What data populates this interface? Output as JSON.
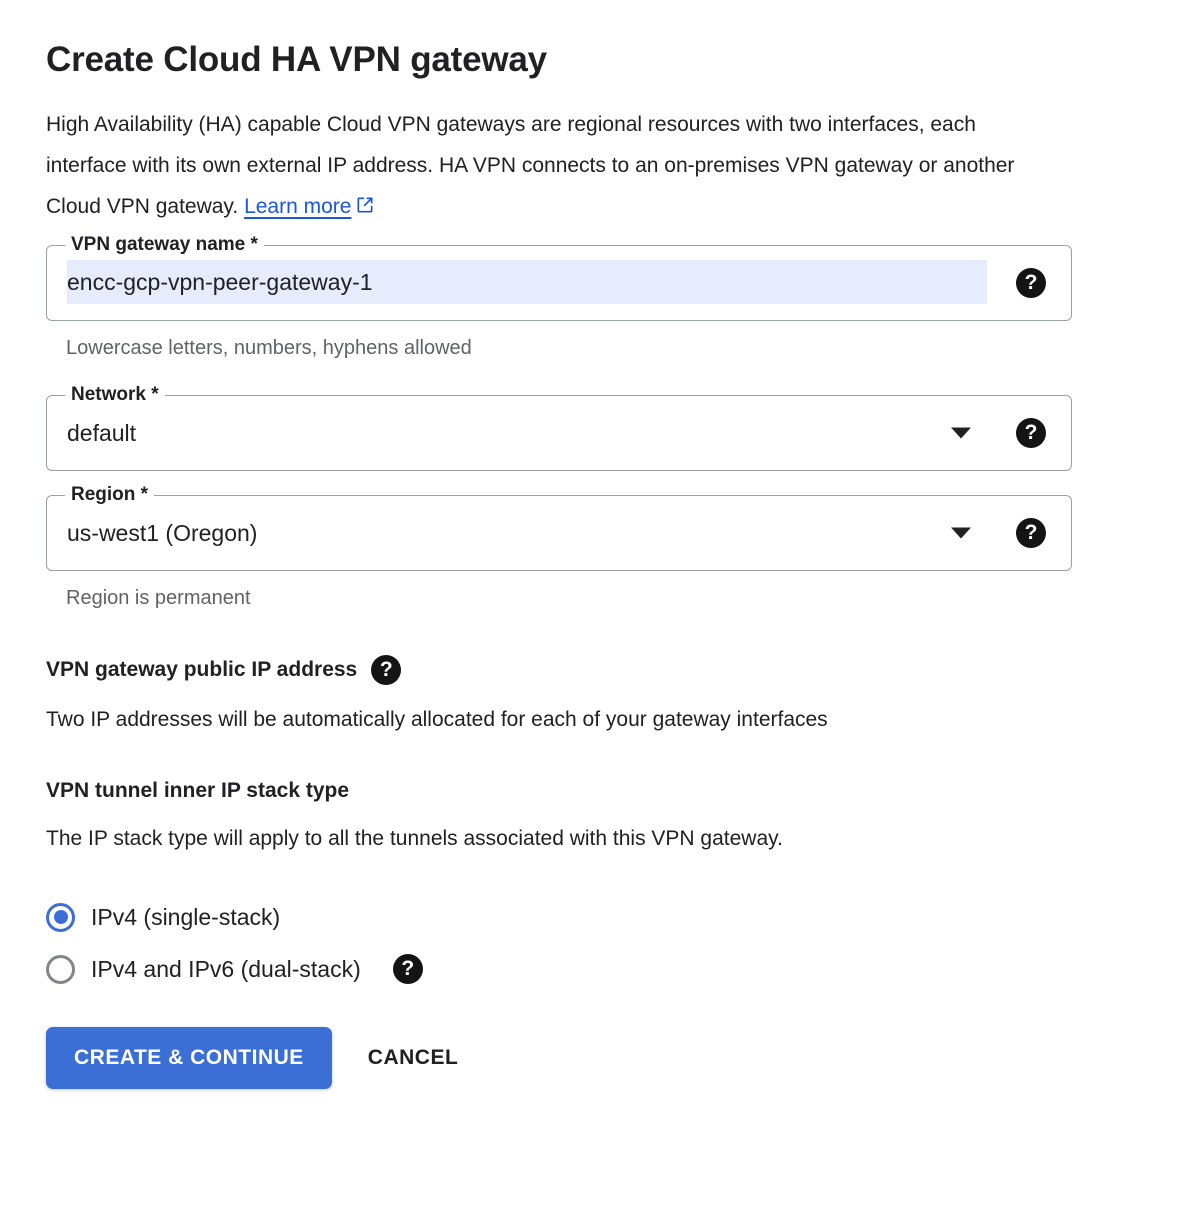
{
  "header": {
    "title": "Create Cloud HA VPN gateway",
    "description_part1": "High Availability (HA) capable Cloud VPN gateways are regional resources with two interfaces, each interface with its own external IP address. HA VPN connects to an on-premises VPN gateway or another Cloud VPN gateway.",
    "learn_more_label": "Learn more",
    "learn_more_icon": "open-in-new-icon"
  },
  "form": {
    "gateway_name": {
      "label": "VPN gateway name *",
      "value": "encc-gcp-vpn-peer-gateway-1",
      "placeholder": "",
      "hint": "Lowercase letters, numbers, hyphens allowed",
      "help_icon": "help-icon"
    },
    "network": {
      "label": "Network *",
      "value": "default",
      "caret_icon": "chevron-down-icon",
      "help_icon": "help-icon"
    },
    "region": {
      "label": "Region *",
      "value": "us-west1 (Oregon)",
      "hint": "Region is permanent",
      "caret_icon": "chevron-down-icon",
      "help_icon": "help-icon"
    }
  },
  "public_ip_section": {
    "title": "VPN gateway public IP address",
    "help_icon": "help-icon",
    "description": "Two IP addresses will be automatically allocated for each of your gateway interfaces"
  },
  "stack_type_section": {
    "title": "VPN tunnel inner IP stack type",
    "description": "The IP stack type will apply to all the tunnels associated with this VPN gateway.",
    "options": [
      {
        "label": "IPv4 (single-stack)",
        "selected": true,
        "help_icon": null
      },
      {
        "label": "IPv4 and IPv6 (dual-stack)",
        "selected": false,
        "help_icon": "help-icon"
      }
    ]
  },
  "actions": {
    "primary_label": "CREATE & CONTINUE",
    "cancel_label": "CANCEL"
  },
  "colors": {
    "accent_blue": "#3c6fd6",
    "link_blue": "#1a56db",
    "selection_highlight": "#e6ecfb",
    "border_gray": "#9aa0a6",
    "hint_gray": "#5f6368",
    "text_primary": "#202124"
  },
  "glyphs": {
    "help": "?"
  }
}
